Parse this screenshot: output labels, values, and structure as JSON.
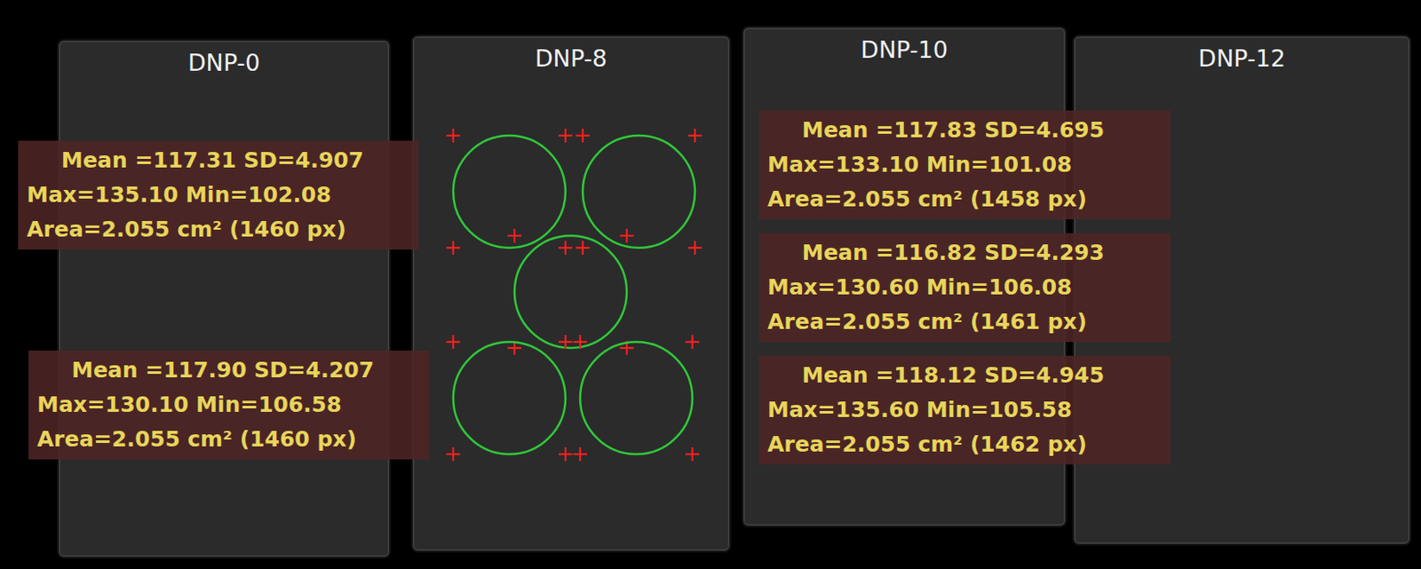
{
  "panels": [
    {
      "label": "DNP-0",
      "kind": "measured",
      "measurements": [
        {
          "lines": [
            "Mean =117.31 SD=4.907",
            "Max=135.10 Min=102.08",
            "Area=2.055 cm² (1460 px)"
          ]
        },
        {
          "lines": [
            "Mean =117.90 SD=4.207",
            "Max=130.10 Min=106.58",
            "Area=2.055 cm² (1460 px)"
          ]
        }
      ]
    },
    {
      "label": "DNP-8",
      "kind": "roi",
      "measurements": []
    },
    {
      "label": "DNP-10",
      "kind": "measured",
      "measurements": [
        {
          "lines": [
            "Mean =117.83 SD=4.695",
            "Max=133.10 Min=101.08",
            "Area=2.055 cm² (1458 px)"
          ]
        },
        {
          "lines": [
            "Mean =116.82 SD=4.293",
            "Max=130.60 Min=106.08",
            "Area=2.055 cm² (1461 px)"
          ]
        },
        {
          "lines": [
            "Mean =118.12 SD=4.945",
            "Max=135.60 Min=105.58",
            "Area=2.055 cm² (1462 px)"
          ]
        }
      ]
    },
    {
      "label": "DNP-12",
      "kind": "plain",
      "measurements": []
    }
  ]
}
